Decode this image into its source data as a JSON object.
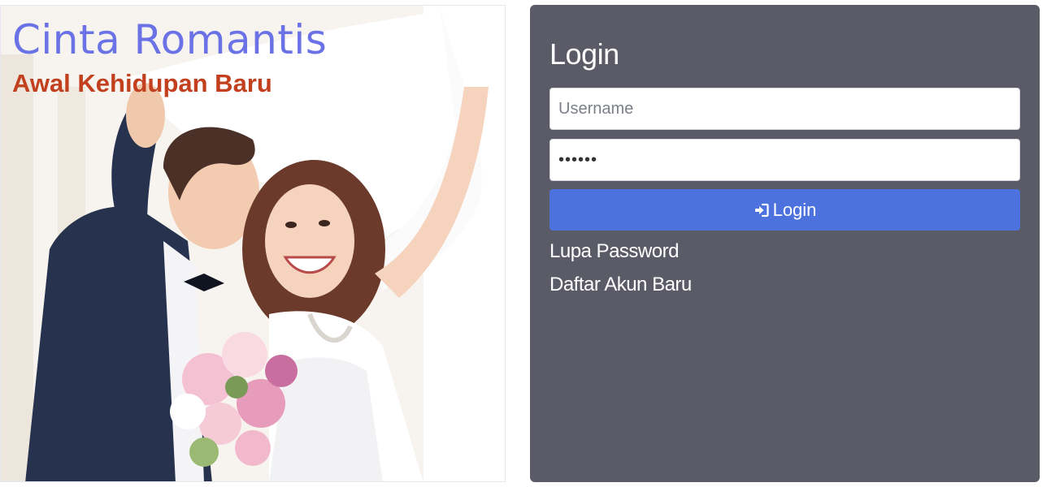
{
  "hero": {
    "title": "Cinta Romantis",
    "subtitle": "Awal Kehidupan Baru",
    "image": "wedding-couple-photo"
  },
  "login": {
    "heading": "Login",
    "username_placeholder": "Username",
    "username_value": "",
    "password_value": "••••••",
    "button_label": "Login",
    "button_icon": "sign-in-icon",
    "forgot_link": "Lupa Password",
    "register_link": "Daftar Akun Baru"
  },
  "colors": {
    "title": "#6a72e6",
    "subtitle": "#c3401f",
    "card_bg": "#5a5b67",
    "button_bg": "#4d72de"
  }
}
